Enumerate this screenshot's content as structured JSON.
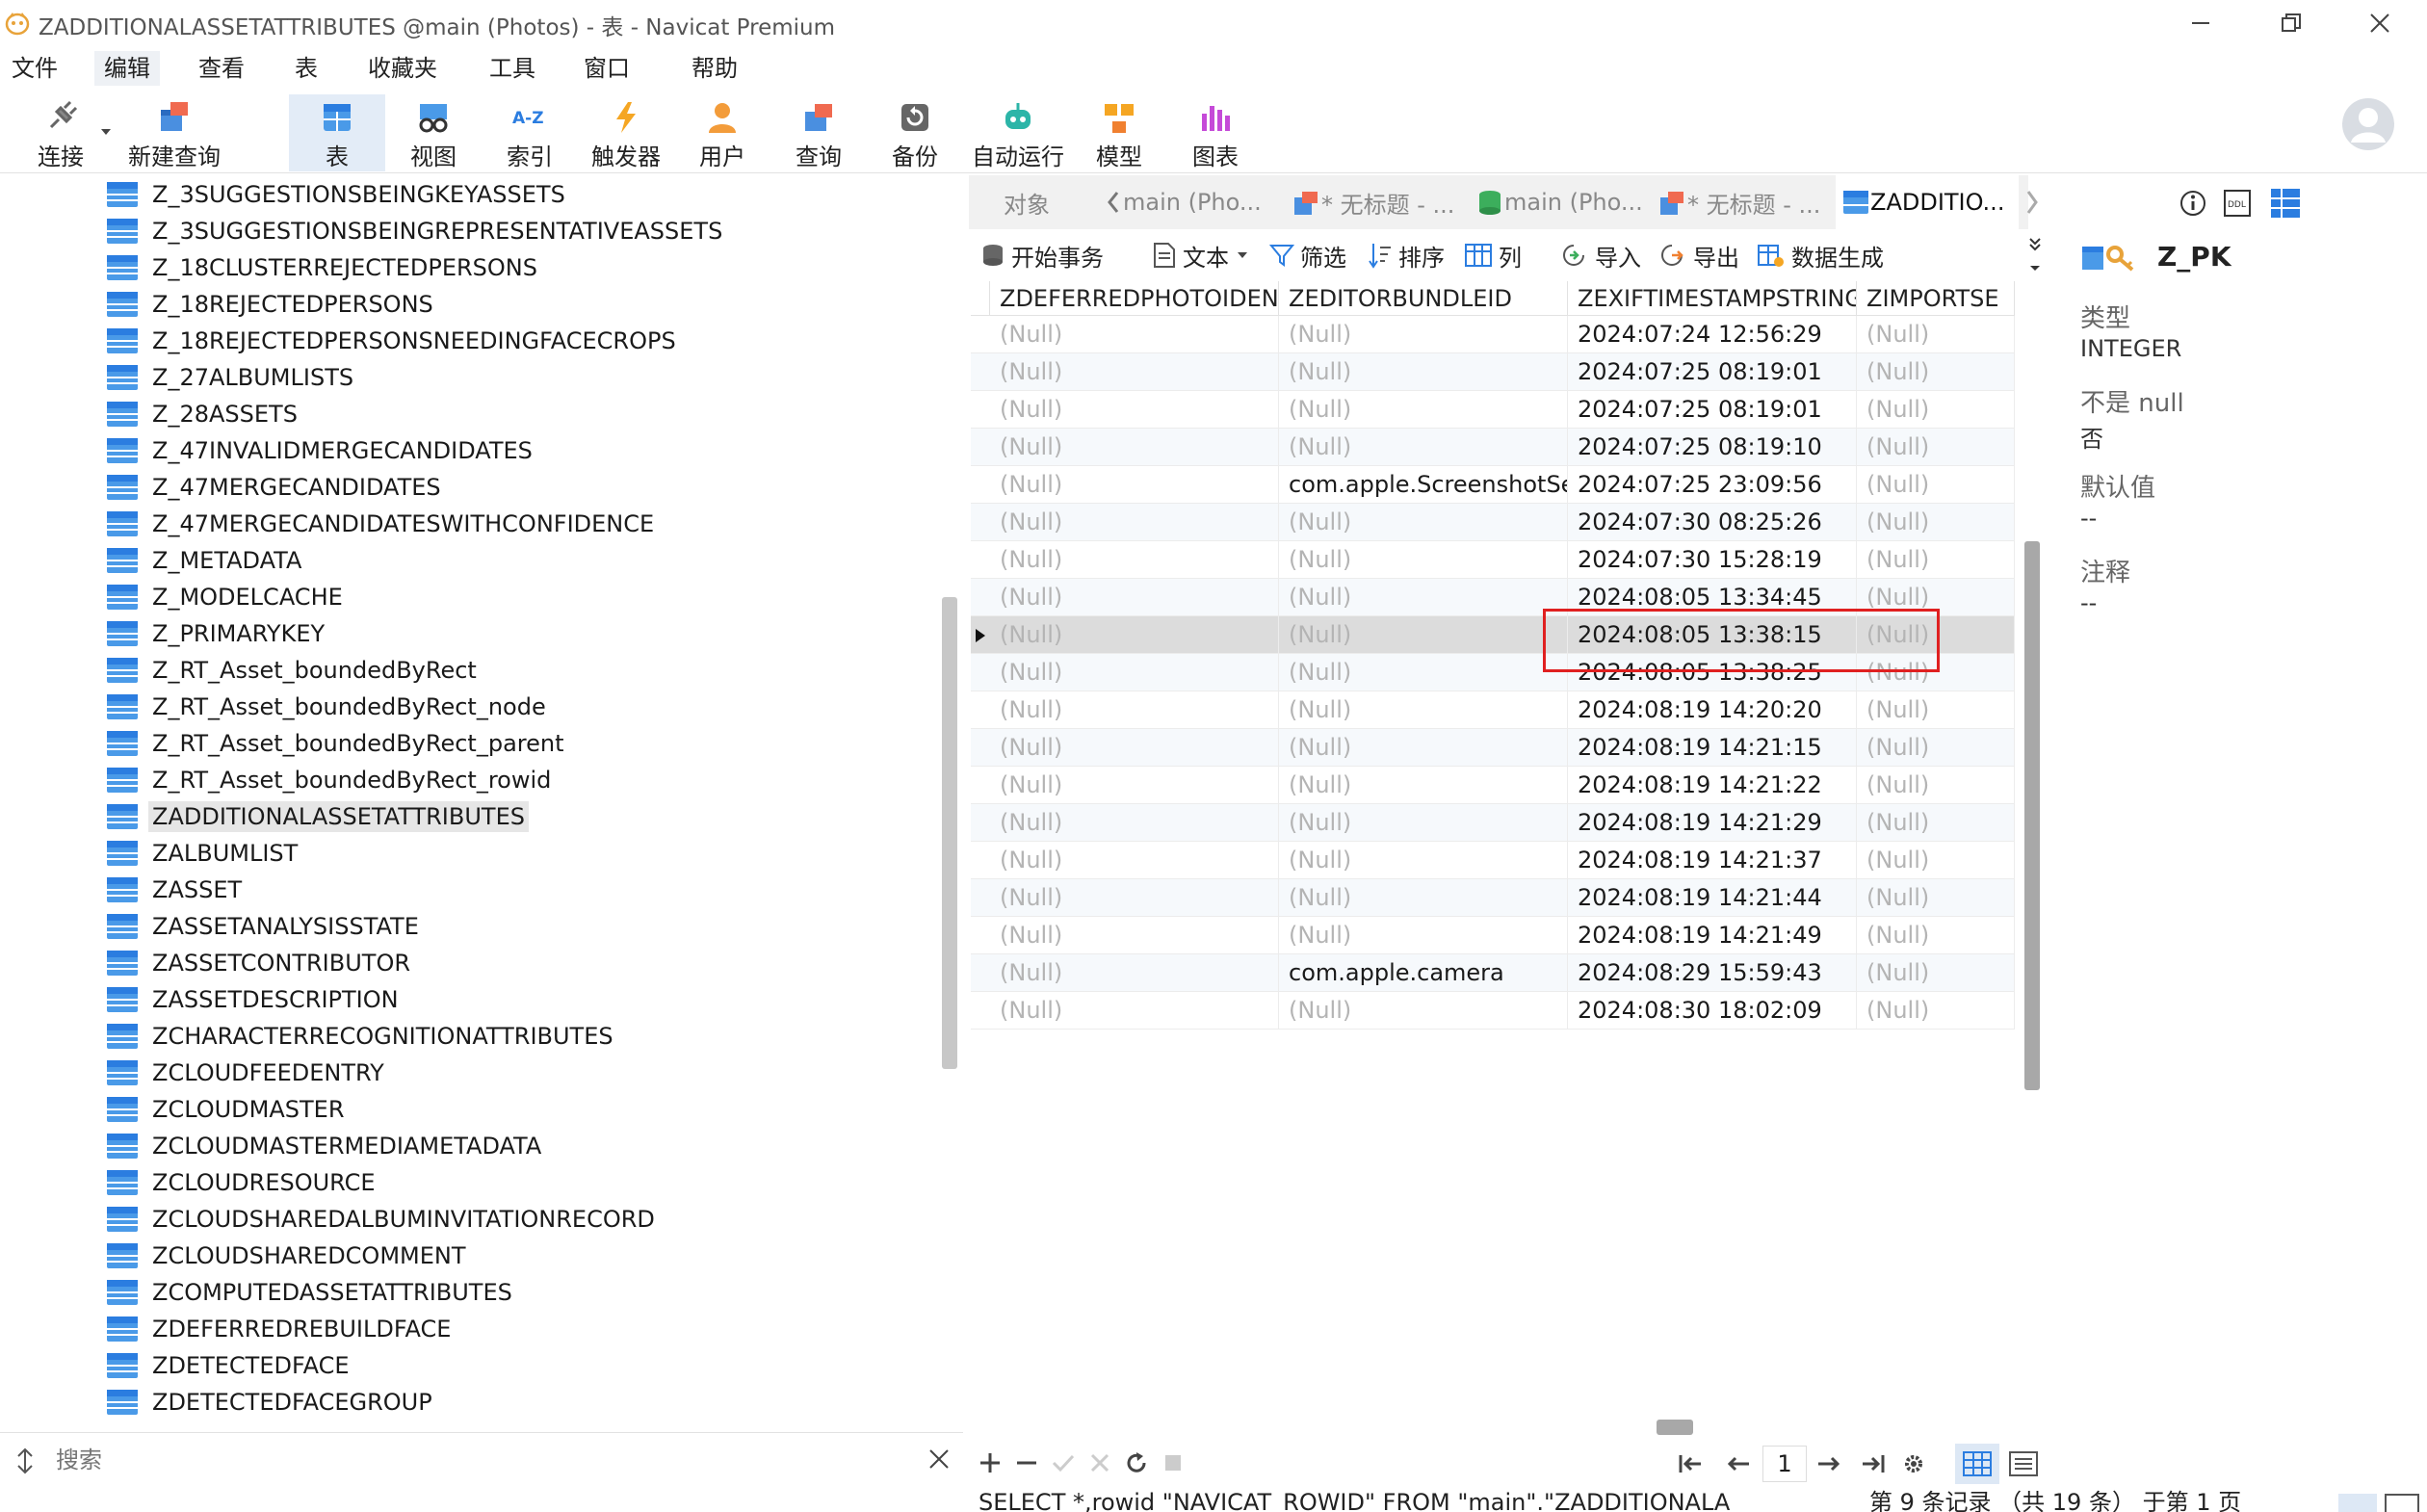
{
  "window": {
    "title": "ZADDITIONALASSETATTRIBUTES @main (Photos) - 表 - Navicat Premium"
  },
  "menu": [
    "文件",
    "编辑",
    "查看",
    "表",
    "收藏夹",
    "工具",
    "窗口",
    "帮助"
  ],
  "toolbar": {
    "connect": "连接",
    "new_query": "新建查询",
    "table": "表",
    "view": "视图",
    "index": "索引",
    "trigger": "触发器",
    "user": "用户",
    "query": "查询",
    "backup": "备份",
    "autorun": "自动运行",
    "model": "模型",
    "chart": "图表"
  },
  "tree_items": [
    "Z_3SUGGESTIONSBEINGKEYASSETS",
    "Z_3SUGGESTIONSBEINGREPRESENTATIVEASSETS",
    "Z_18CLUSTERREJECTEDPERSONS",
    "Z_18REJECTEDPERSONS",
    "Z_18REJECTEDPERSONSNEEDINGFACECROPS",
    "Z_27ALBUMLISTS",
    "Z_28ASSETS",
    "Z_47INVALIDMERGECANDIDATES",
    "Z_47MERGECANDIDATES",
    "Z_47MERGECANDIDATESWITHCONFIDENCE",
    "Z_METADATA",
    "Z_MODELCACHE",
    "Z_PRIMARYKEY",
    "Z_RT_Asset_boundedByRect",
    "Z_RT_Asset_boundedByRect_node",
    "Z_RT_Asset_boundedByRect_parent",
    "Z_RT_Asset_boundedByRect_rowid",
    "ZADDITIONALASSETATTRIBUTES",
    "ZALBUMLIST",
    "ZASSET",
    "ZASSETANALYSISSTATE",
    "ZASSETCONTRIBUTOR",
    "ZASSETDESCRIPTION",
    "ZCHARACTERRECOGNITIONATTRIBUTES",
    "ZCLOUDFEEDENTRY",
    "ZCLOUDMASTER",
    "ZCLOUDMASTERMEDIAMETADATA",
    "ZCLOUDRESOURCE",
    "ZCLOUDSHAREDALBUMINVITATIONRECORD",
    "ZCLOUDSHAREDCOMMENT",
    "ZCOMPUTEDASSETATTRIBUTES",
    "ZDEFERREDREBUILDFACE",
    "ZDETECTEDFACE",
    "ZDETECTEDFACEGROUP"
  ],
  "tree_selected": "ZADDITIONALASSETATTRIBUTES",
  "search": {
    "placeholder": "搜索"
  },
  "tabs": {
    "objects": "对象",
    "t1": "main (Pho...",
    "t2": "* 无标题 - ...",
    "t3": "main (Pho...",
    "t4": "* 无标题 - ...",
    "t5": "ZADDITIO..."
  },
  "grid_toolbar": {
    "begin_tx": "开始事务",
    "text": "文本",
    "filter": "筛选",
    "sort": "排序",
    "columns": "列",
    "import": "导入",
    "export": "导出",
    "datagen": "数据生成"
  },
  "columns": [
    "ZDEFERREDPHOTOIDEN",
    "ZEDITORBUNDLEID",
    "ZEXIFTIMESTAMPSTRING",
    "ZIMPORTSE"
  ],
  "rows": [
    [
      "(Null)",
      "(Null)",
      "2024:07:24 12:56:29",
      "(Null)"
    ],
    [
      "(Null)",
      "(Null)",
      "2024:07:25 08:19:01",
      "(Null)"
    ],
    [
      "(Null)",
      "(Null)",
      "2024:07:25 08:19:01",
      "(Null)"
    ],
    [
      "(Null)",
      "(Null)",
      "2024:07:25 08:19:10",
      "(Null)"
    ],
    [
      "(Null)",
      "com.apple.ScreenshotSe",
      "2024:07:25 23:09:56",
      "(Null)"
    ],
    [
      "(Null)",
      "(Null)",
      "2024:07:30 08:25:26",
      "(Null)"
    ],
    [
      "(Null)",
      "(Null)",
      "2024:07:30 15:28:19",
      "(Null)"
    ],
    [
      "(Null)",
      "(Null)",
      "2024:08:05 13:34:45",
      "(Null)"
    ],
    [
      "(Null)",
      "(Null)",
      "2024:08:05 13:38:15",
      "(Null)"
    ],
    [
      "(Null)",
      "(Null)",
      "2024:08:05 13:38:25",
      "(Null)"
    ],
    [
      "(Null)",
      "(Null)",
      "2024:08:19 14:20:20",
      "(Null)"
    ],
    [
      "(Null)",
      "(Null)",
      "2024:08:19 14:21:15",
      "(Null)"
    ],
    [
      "(Null)",
      "(Null)",
      "2024:08:19 14:21:22",
      "(Null)"
    ],
    [
      "(Null)",
      "(Null)",
      "2024:08:19 14:21:29",
      "(Null)"
    ],
    [
      "(Null)",
      "(Null)",
      "2024:08:19 14:21:37",
      "(Null)"
    ],
    [
      "(Null)",
      "(Null)",
      "2024:08:19 14:21:44",
      "(Null)"
    ],
    [
      "(Null)",
      "(Null)",
      "2024:08:19 14:21:49",
      "(Null)"
    ],
    [
      "(Null)",
      "com.apple.camera",
      "2024:08:29 15:59:43",
      "(Null)"
    ],
    [
      "(Null)",
      "(Null)",
      "2024:08:30 18:02:09",
      "(Null)"
    ]
  ],
  "selected_row": 8,
  "pager": {
    "page": "1"
  },
  "status": {
    "sql": "SELECT *,rowid \"NAVICAT_ROWID\" FROM \"main\".\"ZADDITIONALASSETATTRIBUTES\"",
    "records": "第 9 条记录 （共 19 条） 于第 1 页"
  },
  "props": {
    "name": "Z_PK",
    "type_label": "类型",
    "type_value": "INTEGER",
    "notnull_label": "不是 null",
    "notnull_value": "否",
    "default_label": "默认值",
    "default_value": "--",
    "comment_label": "注释",
    "comment_value": "--"
  },
  "colors": {
    "accent": "#2b7de0",
    "highlight_box": "#e02020",
    "null_text": "#b4b4b4",
    "selected_row": "#dcdcdc"
  }
}
